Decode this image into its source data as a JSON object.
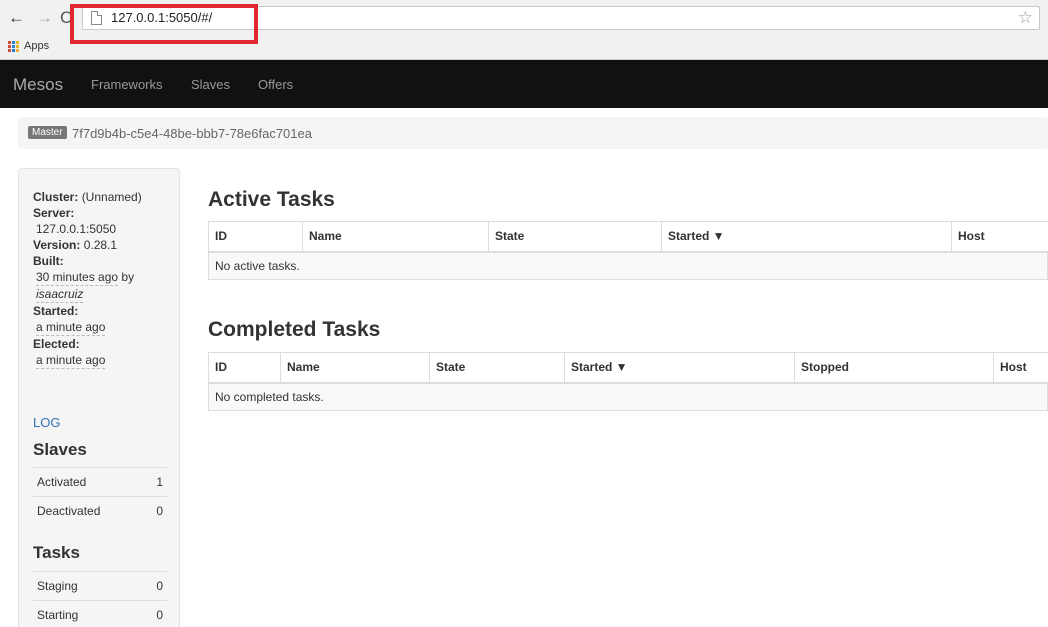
{
  "browser": {
    "url": "127.0.0.1:5050/#/",
    "bookmarks_label": "Apps"
  },
  "navbar": {
    "brand": "Mesos",
    "links": [
      "Frameworks",
      "Slaves",
      "Offers"
    ]
  },
  "breadcrumb": {
    "badge": "Master",
    "master_id": "7f7d9b4b-c5e4-48be-bbb7-78e6fac701ea"
  },
  "sidebar": {
    "cluster_label": "Cluster:",
    "cluster_value": "(Unnamed)",
    "server_label": "Server:",
    "server_value": "127.0.0.1:5050",
    "version_label": "Version:",
    "version_value": "0.28.1",
    "built_label": "Built:",
    "built_value": "30 minutes ago",
    "built_by": "by",
    "built_user": "isaacruiz",
    "started_label": "Started:",
    "started_value": "a minute ago",
    "elected_label": "Elected:",
    "elected_value": "a minute ago",
    "log_link": "LOG",
    "slaves_heading": "Slaves",
    "slaves": [
      {
        "label": "Activated",
        "value": "1"
      },
      {
        "label": "Deactivated",
        "value": "0"
      }
    ],
    "tasks_heading": "Tasks",
    "tasks": [
      {
        "label": "Staging",
        "value": "0"
      },
      {
        "label": "Starting",
        "value": "0"
      }
    ]
  },
  "active_tasks": {
    "heading": "Active Tasks",
    "columns": [
      "ID",
      "Name",
      "State",
      "Started ▼",
      "Host"
    ],
    "empty": "No active tasks."
  },
  "completed_tasks": {
    "heading": "Completed Tasks",
    "columns": [
      "ID",
      "Name",
      "State",
      "Started ▼",
      "Stopped",
      "Host"
    ],
    "empty": "No completed tasks."
  }
}
